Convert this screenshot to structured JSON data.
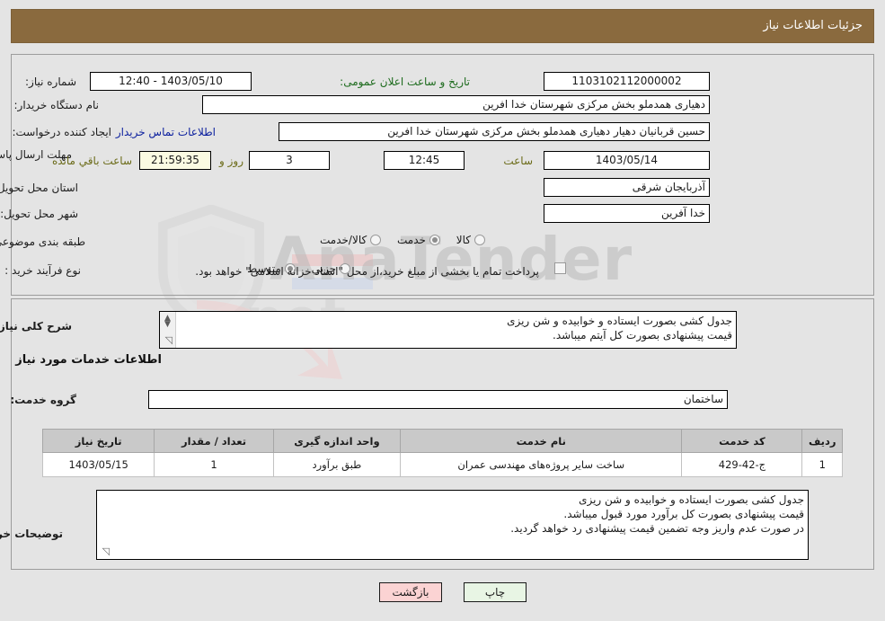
{
  "header": {
    "title": "جزئیات اطلاعات نیاز",
    "bar_color": "#8a6a3e"
  },
  "form": {
    "need_number_label": "شماره نیاز:",
    "need_number_value": "1103102112000002",
    "announce_label": "تاریخ و ساعت اعلان عمومی:",
    "announce_value": "1403/05/10 - 12:40",
    "buyer_org_label": "نام دستگاه خریدار:",
    "buyer_org_value": "دهیاری همدملو بخش مرکزی شهرستان خدا افرین",
    "requester_label": "ایجاد کننده درخواست:",
    "requester_value": "حسین قربانیان دهیار  دهیاری همدملو بخش مرکزی شهرستان خدا افرین",
    "contact_link": "اطلاعات تماس خریدار",
    "deadline_label": "مهلت ارسال پاسخ: تا تاریخ:",
    "deadline_date": "1403/05/14",
    "hour_label": "ساعت",
    "deadline_hour": "12:45",
    "days_value": "3",
    "days_label": "روز و",
    "remaining_time": "21:59:35",
    "remaining_label": "ساعت باقي مانده",
    "province_label": "استان محل تحویل:",
    "province_value": "آذربایجان شرقی",
    "city_label": "شهر محل تحویل:",
    "city_value": "خدا آفرین",
    "category_label": "طبقه بندی موضوعی:",
    "category_options": [
      {
        "label": "کالا",
        "selected": false
      },
      {
        "label": "خدمت",
        "selected": true
      },
      {
        "label": "کالا/خدمت",
        "selected": false
      }
    ],
    "process_label": "نوع فرآیند خرید :",
    "process_options": [
      {
        "label": "جزیي",
        "selected": false
      },
      {
        "label": "متوسط",
        "selected": true
      }
    ],
    "treasury_checkbox_checked": false,
    "treasury_text": "پرداخت تمام یا بخشی از مبلغ خرید،از محل \"اسناد خزانه اسلامی\" خواهد بود."
  },
  "summary": {
    "label": "شرح کلی نیاز:",
    "text": "جدول کشی بصورت ایستاده و خوابیده و شن ریزی\nقیمت پیشنهادی بصورت کل آیتم میباشد."
  },
  "services_section": {
    "heading": "اطلاعات خدمات مورد نیاز",
    "group_label": "گروه خدمت:",
    "group_value": "ساختمان"
  },
  "table": {
    "columns": [
      "ردیف",
      "کد خدمت",
      "نام خدمت",
      "واحد اندازه گیری",
      "تعداد / مقدار",
      "تاریخ نیاز"
    ],
    "rows": [
      {
        "radif": "1",
        "code": "ج-42-429",
        "name": "ساخت سایر پروژه‌های مهندسی عمران",
        "unit": "طبق برآورد",
        "qty": "1",
        "date": "1403/05/15"
      }
    ]
  },
  "buyer_notes": {
    "label": "توضیحات خریدار:",
    "text": "جدول کشی بصورت ایستاده و خوابیده و شن ریزی\nقیمت پیشنهادی بصورت کل برآورد مورد قبول میباشد.\nدر صورت عدم واریز وجه تضمین قیمت پیشنهادی رد خواهد گردید."
  },
  "footer": {
    "print_label": "چاپ",
    "back_label": "بازگشت"
  },
  "watermark": {
    "brand": "AnaTender",
    "domain": ".net"
  }
}
